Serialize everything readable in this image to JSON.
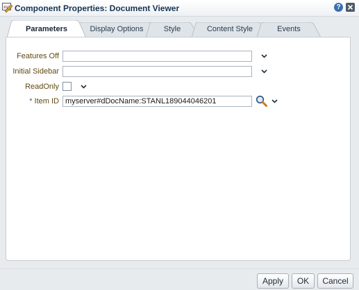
{
  "dialog": {
    "title": "Component Properties: Document Viewer",
    "help_label": "?",
    "title_icon": "component-icon",
    "close_icon": "close-icon"
  },
  "tabs": [
    {
      "label": "Parameters",
      "active": true
    },
    {
      "label": "Display Options",
      "active": false
    },
    {
      "label": "Style",
      "active": false
    },
    {
      "label": "Content Style",
      "active": false
    },
    {
      "label": "Events",
      "active": false
    }
  ],
  "form": {
    "features_off": {
      "label": "Features Off",
      "value": ""
    },
    "initial_sidebar": {
      "label": "Initial Sidebar",
      "value": ""
    },
    "readonly": {
      "label": "ReadOnly",
      "checked": false
    },
    "item_id": {
      "required_mark": "*",
      "label": "Item ID",
      "value": "myserver#dDocName:STANL189044046201"
    }
  },
  "buttons": {
    "apply": "Apply",
    "ok": "OK",
    "cancel": "Cancel"
  }
}
